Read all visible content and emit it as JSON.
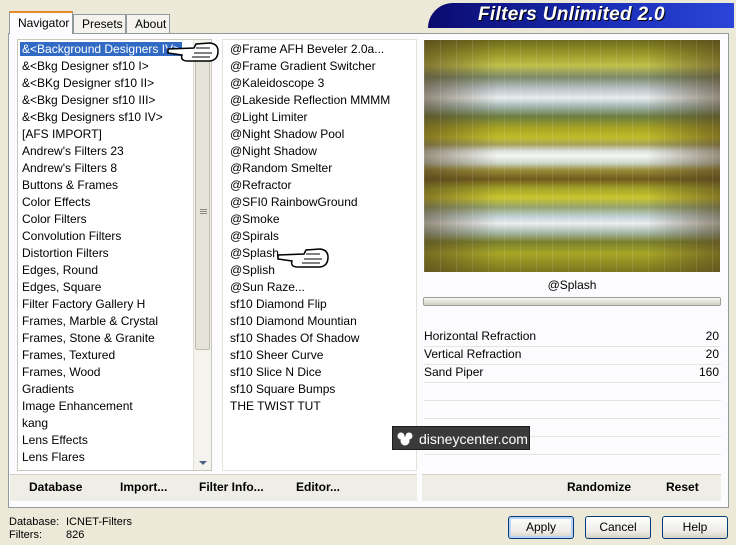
{
  "tabs": [
    {
      "label": "Navigator",
      "active": true
    },
    {
      "label": "Presets",
      "active": false
    },
    {
      "label": "About",
      "active": false
    }
  ],
  "banner": {
    "title": "Filters Unlimited 2.0"
  },
  "categories": [
    "&<Background Designers IV>",
    "&<Bkg Designer sf10 I>",
    "&<BKg Designer sf10 II>",
    "&<Bkg Designer sf10 III>",
    "&<Bkg Designers sf10 IV>",
    "[AFS IMPORT]",
    "Andrew's Filters 23",
    "Andrew's Filters 8",
    "Buttons & Frames",
    "Color Effects",
    "Color Filters",
    "Convolution Filters",
    "Distortion Filters",
    "Edges, Round",
    "Edges, Square",
    "Filter Factory Gallery H",
    "Frames, Marble & Crystal",
    "Frames, Stone & Granite",
    "Frames, Textured",
    "Frames, Wood",
    "Gradients",
    "Image Enhancement",
    "kang",
    "Lens Effects",
    "Lens Flares"
  ],
  "selected_category": "&<Background Designers IV>",
  "filters": [
    "@Frame AFH Beveler 2.0a...",
    "@Frame Gradient Switcher",
    "@Kaleidoscope 3",
    "@Lakeside Reflection MMMM",
    "@Light Limiter",
    "@Night Shadow Pool",
    "@Night Shadow",
    "@Random Smelter",
    "@Refractor",
    "@SFI0 RainbowGround",
    "@Smoke",
    "@Spirals",
    "@Splash",
    "@Splish",
    "@Sun Raze...",
    "sf10 Diamond Flip",
    "sf10 Diamond Mountian",
    "sf10 Shades Of Shadow",
    "sf10 Sheer Curve",
    "sf10 Slice N Dice",
    "sf10 Square Bumps",
    "THE TWIST TUT"
  ],
  "selected_filter": "@Splash",
  "preview": {
    "caption": "@Splash"
  },
  "parameters": [
    {
      "name": "Horizontal Refraction",
      "value": "20"
    },
    {
      "name": "Vertical Refraction",
      "value": "20"
    },
    {
      "name": "Sand Piper",
      "value": "160"
    }
  ],
  "watermark": "disneycenter.com",
  "toolbar": {
    "database": "Database",
    "import": "Import...",
    "filter_info": "Filter Info...",
    "editor": "Editor...",
    "randomize": "Randomize",
    "reset": "Reset"
  },
  "status": {
    "database_label": "Database:",
    "database_value": "ICNET-Filters",
    "filters_label": "Filters:",
    "filters_value": "826"
  },
  "buttons": {
    "apply": "Apply",
    "cancel": "Cancel",
    "help": "Help"
  },
  "colors": {
    "selection": "#316ac5",
    "banner": "#1b2fb8"
  }
}
